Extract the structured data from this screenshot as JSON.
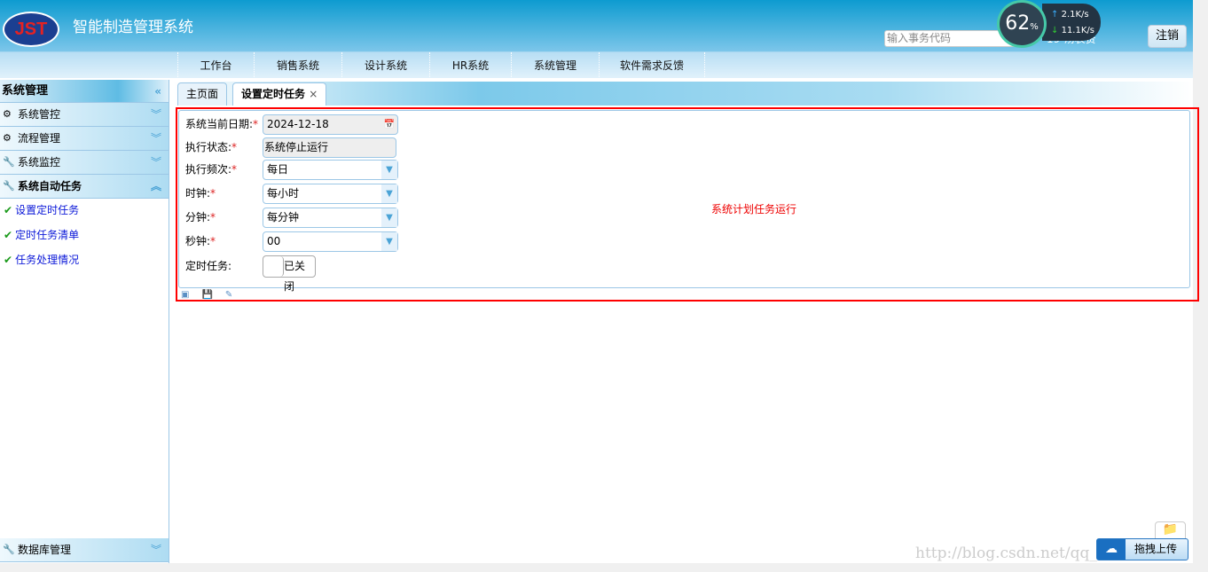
{
  "header": {
    "logo_text": "JST",
    "title": "智能制造管理系统",
    "search_placeholder": "输入事务代码",
    "user": "19-汤表贤",
    "logout": "注销"
  },
  "netmonitor": {
    "cpu": "62",
    "cpu_unit": "%",
    "up": "2.1",
    "down": "11.1",
    "unit": "K/s"
  },
  "nav": [
    "工作台",
    "销售系统",
    "设计系统",
    "HR系统",
    "系统管理",
    "软件需求反馈"
  ],
  "sidebar": {
    "title": "系统管理",
    "groups": [
      {
        "label": "系统管控"
      },
      {
        "label": "流程管理"
      },
      {
        "label": "系统监控"
      },
      {
        "label": "系统自动任务"
      }
    ],
    "items": [
      {
        "label": "设置定时任务"
      },
      {
        "label": "定时任务清单"
      },
      {
        "label": "任务处理情况"
      }
    ],
    "bottom": "数据库管理"
  },
  "tabs": [
    {
      "label": "主页面"
    },
    {
      "label": "设置定时任务",
      "close": "×"
    }
  ],
  "form": {
    "date": {
      "label": "系统当前日期:",
      "value": "2024-12-18"
    },
    "status": {
      "label": "执行状态:",
      "value": "系统停止运行"
    },
    "freq": {
      "label": "执行频次:",
      "value": "每日"
    },
    "hour": {
      "label": "时钟:",
      "value": "每小时"
    },
    "minute": {
      "label": "分钟:",
      "value": "每分钟"
    },
    "second": {
      "label": "秒钟:",
      "value": "00"
    },
    "task": {
      "label": "定时任务:",
      "value": "已关闭",
      "on": false
    },
    "required": "*"
  },
  "message": "系统计划任务运行",
  "upload": {
    "label": "拖拽上传"
  },
  "watermark": "http://blog.csdn.net/qq_23053003"
}
